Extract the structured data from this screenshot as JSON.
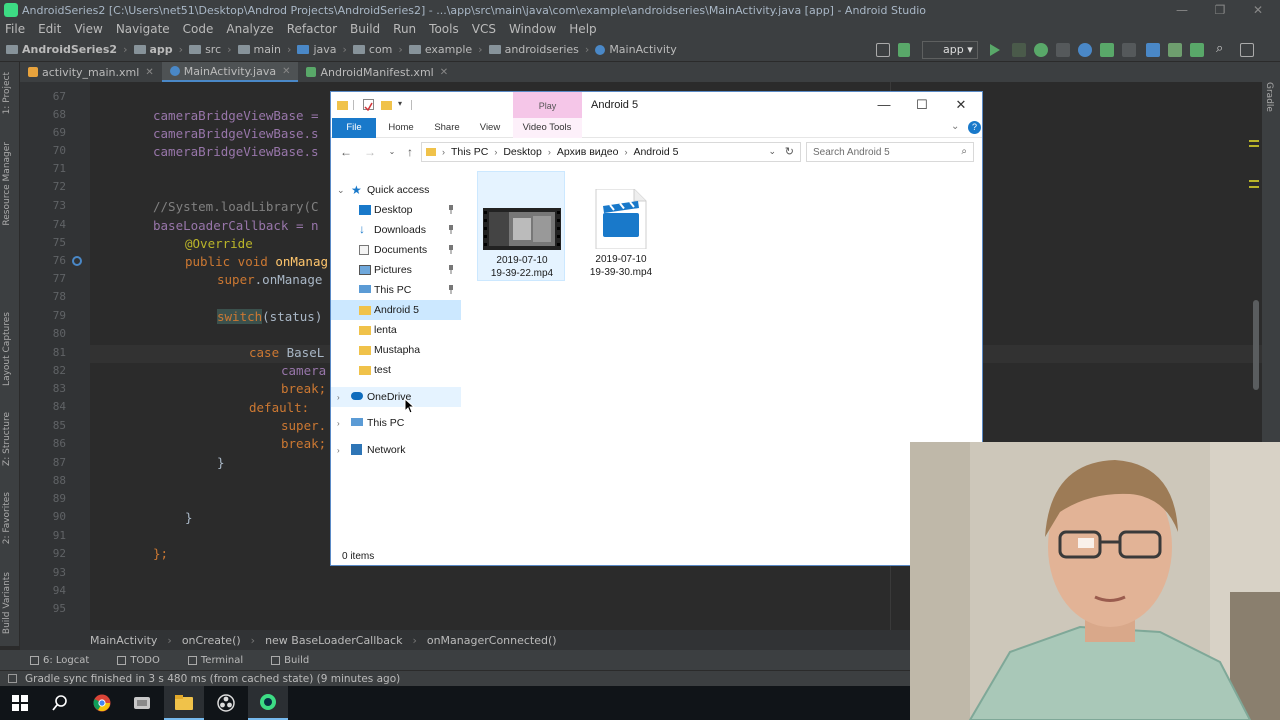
{
  "ide": {
    "title": "AndroidSeries2 [C:\\Users\\net51\\Desktop\\Androd Projects\\AndroidSeries2] - ...\\app\\src\\main\\java\\com\\example\\androidseries\\MainActivity.java [app] - Android Studio",
    "menu": [
      "File",
      "Edit",
      "View",
      "Navigate",
      "Code",
      "Analyze",
      "Refactor",
      "Build",
      "Run",
      "Tools",
      "VCS",
      "Window",
      "Help"
    ],
    "nav_path": [
      "AndroidSeries2",
      "app",
      "src",
      "main",
      "java",
      "com",
      "example",
      "androidseries",
      "MainActivity"
    ],
    "run_config": "app",
    "tabs": [
      "activity_main.xml",
      "MainActivity.java",
      "AndroidManifest.xml"
    ],
    "active_tab": "MainActivity.java",
    "line_numbers": [
      "67",
      "68",
      "69",
      "70",
      "71",
      "72",
      "73",
      "74",
      "75",
      "76",
      "77",
      "78",
      "79",
      "80",
      "81",
      "82",
      "83",
      "84",
      "85",
      "86",
      "87",
      "88",
      "89",
      "90",
      "91",
      "92",
      "93",
      "94",
      "95"
    ],
    "code": {
      "l68a": "cameraBridgeViewBase =",
      "l69a": "cameraBridgeViewBase.s",
      "l70a": "cameraBridgeViewBase.s",
      "l73": "//System.loadLibrary(C",
      "l74a": "baseLoaderCallback = n",
      "l75": "@Override",
      "l76a": "public void",
      "l76b": "onManag",
      "l77a": "super",
      "l77b": ".onManage",
      "l79a": "switch",
      "l79b": "(status)",
      "l81a": "case",
      "l81b": " BaseL",
      "l82": "camera",
      "l83": "break;",
      "l84": "default:",
      "l85": "super.",
      "l86": "break;",
      "l87": "}",
      "l90": "}",
      "l92": "};"
    },
    "breadcrumb": [
      "MainActivity",
      "onCreate()",
      "new BaseLoaderCallback",
      "onManagerConnected()"
    ],
    "bottom_tabs": [
      "6: Logcat",
      "TODO",
      "Terminal",
      "Build"
    ],
    "status": "Gradle sync finished in 3 s 480 ms (from cached state) (9 minutes ago)",
    "left_tool_windows": [
      "1: Project",
      "Resource Manager",
      "Layout Captures",
      "Z: Structure",
      "2: Favorites",
      "Build Variants"
    ],
    "right_tool_windows": [
      "Gradle"
    ]
  },
  "explorer": {
    "title": "Android 5",
    "context_tab_header": "Play",
    "ribbon_tabs": [
      "File",
      "Home",
      "Share",
      "View",
      "Video Tools"
    ],
    "address": [
      "This PC",
      "Desktop",
      "Архив видео",
      "Android 5"
    ],
    "search_placeholder": "Search Android 5",
    "nav": {
      "quick_access": "Quick access",
      "pinned": [
        "Desktop",
        "Downloads",
        "Documents",
        "Pictures",
        "This PC"
      ],
      "folders": [
        "Android 5",
        "lenta",
        "Mustapha",
        "test"
      ],
      "onedrive": "OneDrive",
      "this_pc": "This PC",
      "network": "Network"
    },
    "files": [
      {
        "line1": "2019-07-10",
        "line2": "19-39-22.mp4",
        "type": "video-thumbnail"
      },
      {
        "line1": "2019-07-10",
        "line2": "19-39-30.mp4",
        "type": "clapperboard-icon"
      }
    ],
    "status": "0 items"
  },
  "colors": {
    "ide_bg": "#2b2b2b",
    "ide_panel": "#3c3f41",
    "keyword": "#cc7832",
    "field": "#9876aa",
    "explorer_accent": "#1979ca",
    "selection": "#cce8ff"
  }
}
